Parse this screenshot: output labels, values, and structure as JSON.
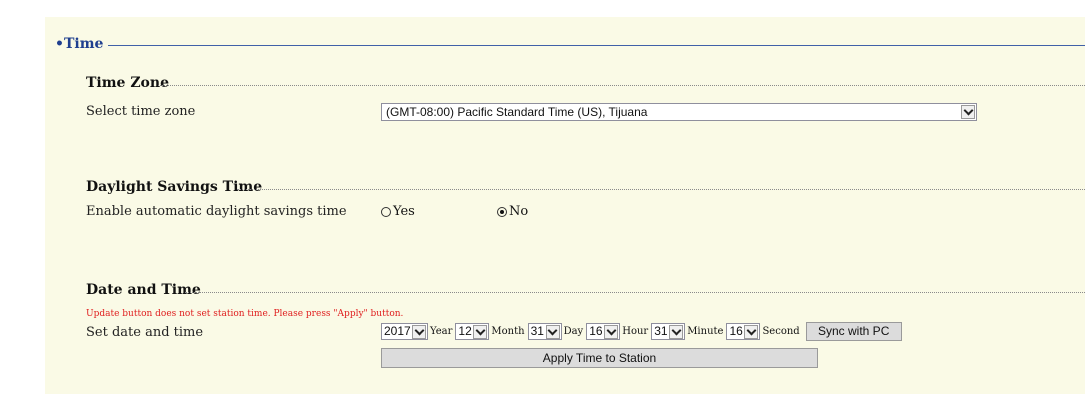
{
  "section": {
    "title": "Time"
  },
  "timezone": {
    "heading": "Time Zone",
    "label": "Select time zone",
    "selected": "(GMT-08:00) Pacific Standard Time (US), Tijuana"
  },
  "dst": {
    "heading": "Daylight Savings Time",
    "label": "Enable automatic daylight savings time",
    "yes": "Yes",
    "no": "No",
    "selected": "No"
  },
  "datetime": {
    "heading": "Date and Time",
    "warning": "Update button does not set station time. Please press \"Apply\" button.",
    "label": "Set date and time",
    "year": "2017",
    "year_unit": "Year",
    "month": "12",
    "month_unit": "Month",
    "day": "31",
    "day_unit": "Day",
    "hour": "16",
    "hour_unit": "Hour",
    "minute": "31",
    "minute_unit": "Minute",
    "second": "16",
    "second_unit": "Second",
    "sync_label": "Sync with PC",
    "apply_label": "Apply Time to Station"
  }
}
